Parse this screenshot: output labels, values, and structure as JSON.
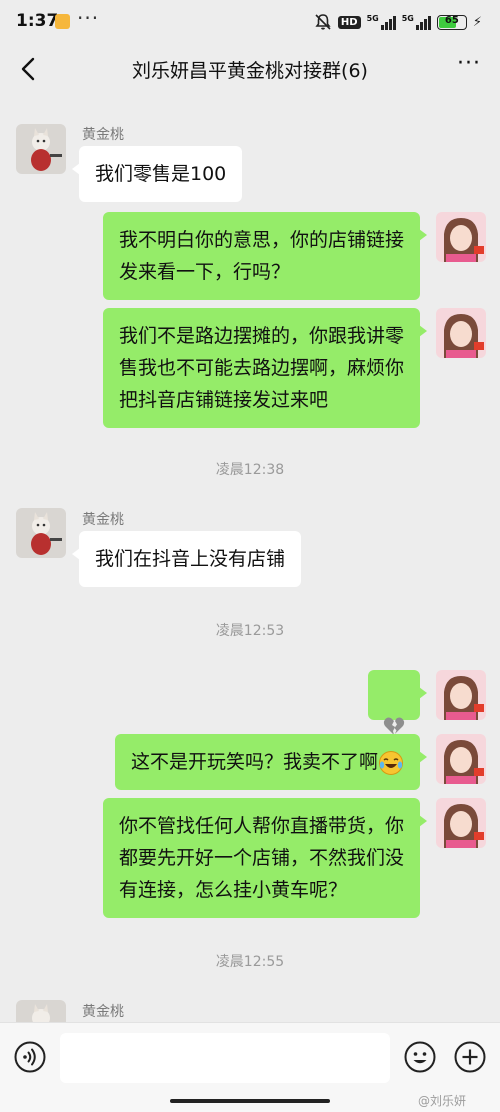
{
  "status_bar": {
    "time": "1:37",
    "dots": "···",
    "hd": "HD",
    "net1": "5G",
    "net2": "5G",
    "battery": "65",
    "battery_level": 0.65
  },
  "header": {
    "title": "刘乐妍昌平黄金桃对接群(6)",
    "more": "···"
  },
  "messages": {
    "m1": {
      "sender": "黄金桃",
      "text": "我们零售是100"
    },
    "m2": {
      "text": "我不明白你的意思，你的店铺链接\n发来看一下，行吗？"
    },
    "m3": {
      "text": "我们不是路边摆摊的，你跟我讲零\n售我也不可能去路边摆啊，麻烦你\n把抖音店铺链接发过来吧"
    },
    "t1": "凌晨12:38",
    "m4": {
      "sender": "黄金桃",
      "text": "我们在抖音上没有店铺"
    },
    "t2": "凌晨12:53",
    "m5": {
      "emoji": "broken-heart"
    },
    "m6": {
      "text": "这不是开玩笑吗？我卖不了啊",
      "emoji": "laughing-crying-face"
    },
    "m7": {
      "text": "你不管找任何人帮你直播带货，你\n都要先开好一个店铺，不然我们没\n有连接，怎么挂小黄车呢？"
    },
    "t3": "凌晨12:55",
    "m8": {
      "sender": "黄金桃"
    }
  },
  "watermark": "@刘乐妍",
  "icons": [
    "back-icon",
    "more-icon",
    "voice-icon",
    "emoji-icon",
    "plus-icon",
    "broken-heart-icon",
    "laughing-crying-icon",
    "mute-icon"
  ],
  "colors": {
    "background": "#ededed",
    "my_bubble": "#95ec69",
    "their_bubble": "#ffffff"
  }
}
